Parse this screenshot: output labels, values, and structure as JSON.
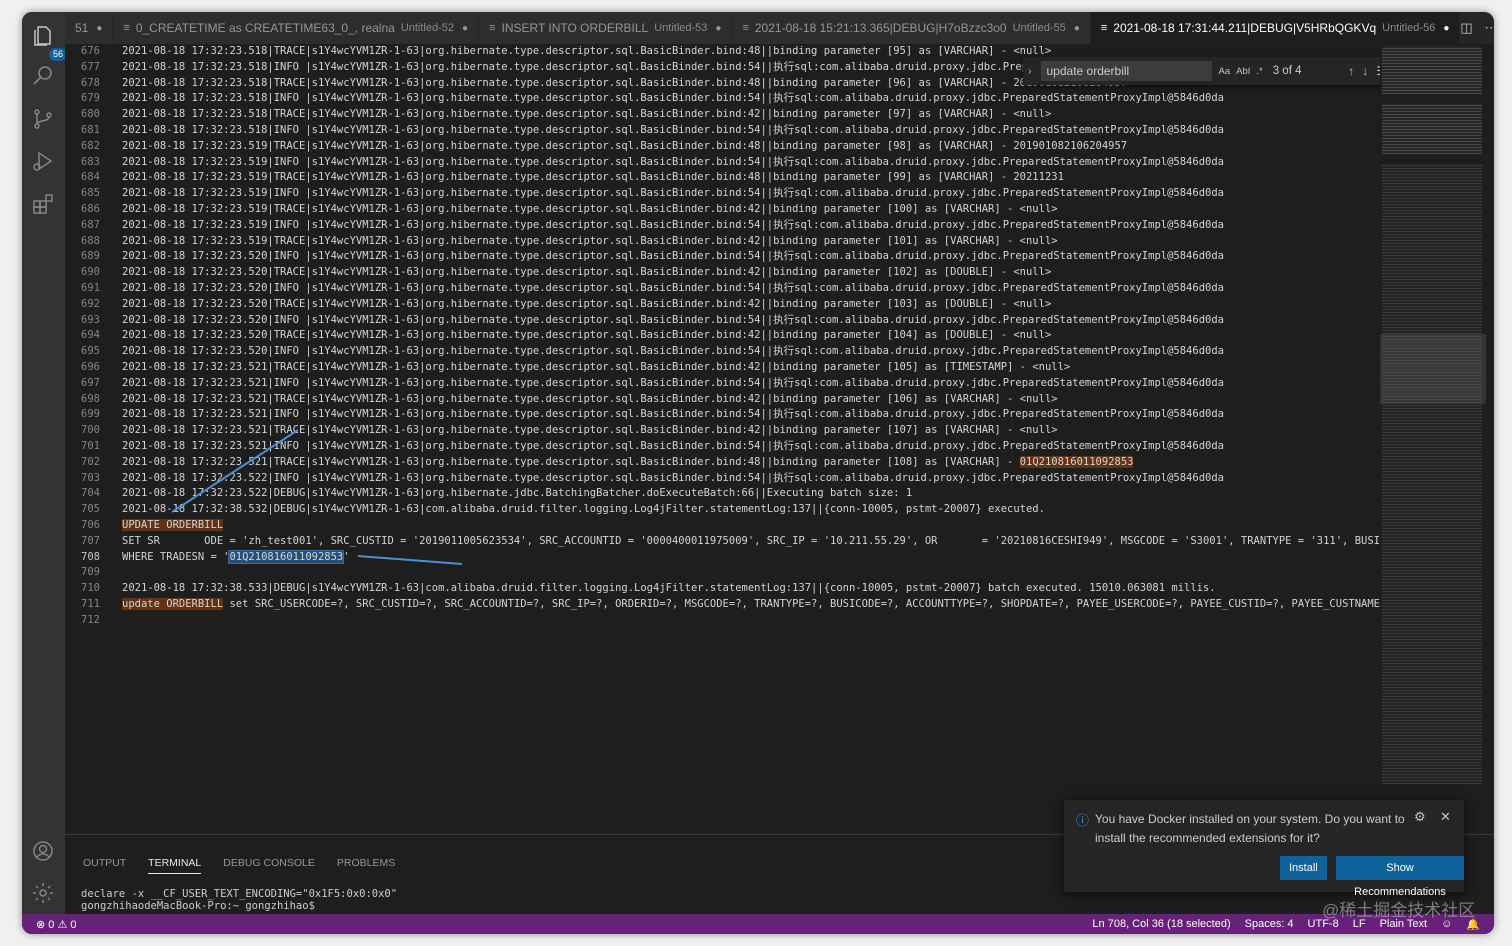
{
  "activity": {
    "badge": "56"
  },
  "tabs": [
    {
      "name": "51",
      "desc": "",
      "dot": "●"
    },
    {
      "name": "0_CREATETIME as CREATETIME63_0_, realna",
      "desc": "Untitled-52",
      "dot": "●"
    },
    {
      "name": "INSERT INTO ORDERBILL",
      "desc": "Untitled-53",
      "dot": "●"
    },
    {
      "name": "2021-08-18 15:21:13.365|DEBUG|H7oBzzc3o0",
      "desc": "Untitled-55",
      "dot": "●"
    },
    {
      "name": "2021-08-18 17:31:44.211|DEBUG|V5HRbQGKVq",
      "desc": "Untitled-56",
      "dot": "●"
    }
  ],
  "find": {
    "query": "update orderbill",
    "count": "3 of 4",
    "opt_case": "Aa",
    "opt_word": "AbI",
    "opt_regex": ".*"
  },
  "lines": [
    {
      "n": "676",
      "t": "2021-08-18 17:32:23.518|TRACE|s1Y4wcYVM1ZR-1-63|org.hibernate.type.descriptor.sql.BasicBinder.bind:48||binding parameter [95] as [VARCHAR] - <null>"
    },
    {
      "n": "677",
      "t": "2021-08-18 17:32:23.518|INFO |s1Y4wcYVM1ZR-1-63|org.hibernate.type.descriptor.sql.BasicBinder.bind:54||执行sql:com.alibaba.druid.proxy.jdbc.PreparedStatementProxyImpl@5846d0da"
    },
    {
      "n": "678",
      "t": "2021-08-18 17:32:23.518|TRACE|s1Y4wcYVM1ZR-1-63|org.hibernate.type.descriptor.sql.BasicBinder.bind:48||binding parameter [96] as [VARCHAR] - 201901082106204957"
    },
    {
      "n": "679",
      "t": "2021-08-18 17:32:23.518|INFO |s1Y4wcYVM1ZR-1-63|org.hibernate.type.descriptor.sql.BasicBinder.bind:54||执行sql:com.alibaba.druid.proxy.jdbc.PreparedStatementProxyImpl@5846d0da"
    },
    {
      "n": "680",
      "t": "2021-08-18 17:32:23.518|TRACE|s1Y4wcYVM1ZR-1-63|org.hibernate.type.descriptor.sql.BasicBinder.bind:42||binding parameter [97] as [VARCHAR] - <null>"
    },
    {
      "n": "681",
      "t": "2021-08-18 17:32:23.518|INFO |s1Y4wcYVM1ZR-1-63|org.hibernate.type.descriptor.sql.BasicBinder.bind:54||执行sql:com.alibaba.druid.proxy.jdbc.PreparedStatementProxyImpl@5846d0da"
    },
    {
      "n": "682",
      "t": "2021-08-18 17:32:23.519|TRACE|s1Y4wcYVM1ZR-1-63|org.hibernate.type.descriptor.sql.BasicBinder.bind:48||binding parameter [98] as [VARCHAR] - 201901082106204957"
    },
    {
      "n": "683",
      "t": "2021-08-18 17:32:23.519|INFO |s1Y4wcYVM1ZR-1-63|org.hibernate.type.descriptor.sql.BasicBinder.bind:54||执行sql:com.alibaba.druid.proxy.jdbc.PreparedStatementProxyImpl@5846d0da"
    },
    {
      "n": "684",
      "t": "2021-08-18 17:32:23.519|TRACE|s1Y4wcYVM1ZR-1-63|org.hibernate.type.descriptor.sql.BasicBinder.bind:48||binding parameter [99] as [VARCHAR] - 20211231"
    },
    {
      "n": "685",
      "t": "2021-08-18 17:32:23.519|INFO |s1Y4wcYVM1ZR-1-63|org.hibernate.type.descriptor.sql.BasicBinder.bind:54||执行sql:com.alibaba.druid.proxy.jdbc.PreparedStatementProxyImpl@5846d0da"
    },
    {
      "n": "686",
      "t": "2021-08-18 17:32:23.519|TRACE|s1Y4wcYVM1ZR-1-63|org.hibernate.type.descriptor.sql.BasicBinder.bind:42||binding parameter [100] as [VARCHAR] - <null>"
    },
    {
      "n": "687",
      "t": "2021-08-18 17:32:23.519|INFO |s1Y4wcYVM1ZR-1-63|org.hibernate.type.descriptor.sql.BasicBinder.bind:54||执行sql:com.alibaba.druid.proxy.jdbc.PreparedStatementProxyImpl@5846d0da"
    },
    {
      "n": "688",
      "t": "2021-08-18 17:32:23.519|TRACE|s1Y4wcYVM1ZR-1-63|org.hibernate.type.descriptor.sql.BasicBinder.bind:42||binding parameter [101] as [VARCHAR] - <null>"
    },
    {
      "n": "689",
      "t": "2021-08-18 17:32:23.520|INFO |s1Y4wcYVM1ZR-1-63|org.hibernate.type.descriptor.sql.BasicBinder.bind:54||执行sql:com.alibaba.druid.proxy.jdbc.PreparedStatementProxyImpl@5846d0da"
    },
    {
      "n": "690",
      "t": "2021-08-18 17:32:23.520|TRACE|s1Y4wcYVM1ZR-1-63|org.hibernate.type.descriptor.sql.BasicBinder.bind:42||binding parameter [102] as [DOUBLE] - <null>"
    },
    {
      "n": "691",
      "t": "2021-08-18 17:32:23.520|INFO |s1Y4wcYVM1ZR-1-63|org.hibernate.type.descriptor.sql.BasicBinder.bind:54||执行sql:com.alibaba.druid.proxy.jdbc.PreparedStatementProxyImpl@5846d0da"
    },
    {
      "n": "692",
      "t": "2021-08-18 17:32:23.520|TRACE|s1Y4wcYVM1ZR-1-63|org.hibernate.type.descriptor.sql.BasicBinder.bind:42||binding parameter [103] as [DOUBLE] - <null>"
    },
    {
      "n": "693",
      "t": "2021-08-18 17:32:23.520|INFO |s1Y4wcYVM1ZR-1-63|org.hibernate.type.descriptor.sql.BasicBinder.bind:54||执行sql:com.alibaba.druid.proxy.jdbc.PreparedStatementProxyImpl@5846d0da"
    },
    {
      "n": "694",
      "t": "2021-08-18 17:32:23.520|TRACE|s1Y4wcYVM1ZR-1-63|org.hibernate.type.descriptor.sql.BasicBinder.bind:42||binding parameter [104] as [DOUBLE] - <null>"
    },
    {
      "n": "695",
      "t": "2021-08-18 17:32:23.520|INFO |s1Y4wcYVM1ZR-1-63|org.hibernate.type.descriptor.sql.BasicBinder.bind:54||执行sql:com.alibaba.druid.proxy.jdbc.PreparedStatementProxyImpl@5846d0da"
    },
    {
      "n": "696",
      "t": "2021-08-18 17:32:23.521|TRACE|s1Y4wcYVM1ZR-1-63|org.hibernate.type.descriptor.sql.BasicBinder.bind:42||binding parameter [105] as [TIMESTAMP] - <null>"
    },
    {
      "n": "697",
      "t": "2021-08-18 17:32:23.521|INFO |s1Y4wcYVM1ZR-1-63|org.hibernate.type.descriptor.sql.BasicBinder.bind:54||执行sql:com.alibaba.druid.proxy.jdbc.PreparedStatementProxyImpl@5846d0da"
    },
    {
      "n": "698",
      "t": "2021-08-18 17:32:23.521|TRACE|s1Y4wcYVM1ZR-1-63|org.hibernate.type.descriptor.sql.BasicBinder.bind:42||binding parameter [106] as [VARCHAR] - <null>"
    },
    {
      "n": "699",
      "t": "2021-08-18 17:32:23.521|INFO |s1Y4wcYVM1ZR-1-63|org.hibernate.type.descriptor.sql.BasicBinder.bind:54||执行sql:com.alibaba.druid.proxy.jdbc.PreparedStatementProxyImpl@5846d0da"
    },
    {
      "n": "700",
      "t": "2021-08-18 17:32:23.521|TRACE|s1Y4wcYVM1ZR-1-63|org.hibernate.type.descriptor.sql.BasicBinder.bind:42||binding parameter [107] as [VARCHAR] - <null>"
    },
    {
      "n": "701",
      "t": "2021-08-18 17:32:23.521|INFO |s1Y4wcYVM1ZR-1-63|org.hibernate.type.descriptor.sql.BasicBinder.bind:54||执行sql:com.alibaba.druid.proxy.jdbc.PreparedStatementProxyImpl@5846d0da"
    },
    {
      "n": "702",
      "t": "2021-08-18 17:32:23.521|TRACE|s1Y4wcYVM1ZR-1-63|org.hibernate.type.descriptor.sql.BasicBinder.bind:48||binding parameter [108] as [VARCHAR] - ",
      "hl": "01Q210816011092853"
    },
    {
      "n": "703",
      "t": "2021-08-18 17:32:23.522|INFO |s1Y4wcYVM1ZR-1-63|org.hibernate.type.descriptor.sql.BasicBinder.bind:54||执行sql:com.alibaba.druid.proxy.jdbc.PreparedStatementProxyImpl@5846d0da"
    },
    {
      "n": "704",
      "t": "2021-08-18 17:32:23.522|DEBUG|s1Y4wcYVM1ZR-1-63|org.hibernate.jdbc.BatchingBatcher.doExecuteBatch:66||Executing batch size: 1"
    },
    {
      "n": "705",
      "t": "2021-08-18 17:32:38.532|DEBUG|s1Y4wcYVM1ZR-1-63|com.alibaba.druid.filter.logging.Log4jFilter.statementLog:137||{conn-10005, pstmt-20007} executed."
    },
    {
      "n": "706",
      "pre": "",
      "hl": "UPDATE ORDERBILL",
      "t": ""
    },
    {
      "n": "707",
      "t": "SET SR       ODE = 'zh_test001', SRC_CUSTID = '2019011005623534', SRC_ACCOUNTID = '0000400011975009', SRC_IP = '10.211.55.29', OR       = '20210816CESHI949', MSGCODE = 'S3001', TRANTYPE = '311', BUSICODE = '"
    },
    {
      "n": "708",
      "pre": "WHERE TRADESN = '",
      "sel": "01Q210816011092853",
      "t": "'",
      "cur": true
    },
    {
      "n": "709",
      "t": ""
    },
    {
      "n": "710",
      "t": "2021-08-18 17:32:38.533|DEBUG|s1Y4wcYVM1ZR-1-63|com.alibaba.druid.filter.logging.Log4jFilter.statementLog:137||{conn-10005, pstmt-20007} batch executed. 15010.063081 millis."
    },
    {
      "n": "711",
      "pre": "",
      "hl": "update ORDERBILL",
      "t": " set SRC_USERCODE=?, SRC_CUSTID=?, SRC_ACCOUNTID=?, SRC_IP=?, ORDERID=?, MSGCODE=?, TRANTYPE=?, BUSICODE=?, ACCOUNTTYPE=?, SHOPDATE=?, PAYEE_USERCODE=?, PAYEE_CUSTID=?, PAYEE_CUSTNAME=?"
    },
    {
      "n": "712",
      "t": ""
    }
  ],
  "panel": {
    "tabs": [
      "OUTPUT",
      "TERMINAL",
      "DEBUG CONSOLE",
      "PROBLEMS"
    ],
    "terminal": [
      "declare -x __CF_USER_TEXT_ENCODING=\"0x1F5:0x0:0x0\"",
      "gongzhihaodeMacBook-Pro:~ gongzhihao$"
    ]
  },
  "notification": {
    "message": "You have Docker installed on your system. Do you want to install the recommended extensions for it?",
    "install": "Install",
    "show": "Show Recommendations"
  },
  "status": {
    "errors": "0",
    "warnings": "0",
    "position": "Ln 708, Col 36 (18 selected)",
    "spaces": "Spaces: 4",
    "encoding": "UTF-8",
    "eol": "LF",
    "language": "Plain Text"
  },
  "watermark": "@稀土掘金技术社区",
  "colors": {
    "statusbar": "#68217a",
    "accent": "#0e639c",
    "find_highlight": "#613214",
    "selection": "#264f78"
  }
}
